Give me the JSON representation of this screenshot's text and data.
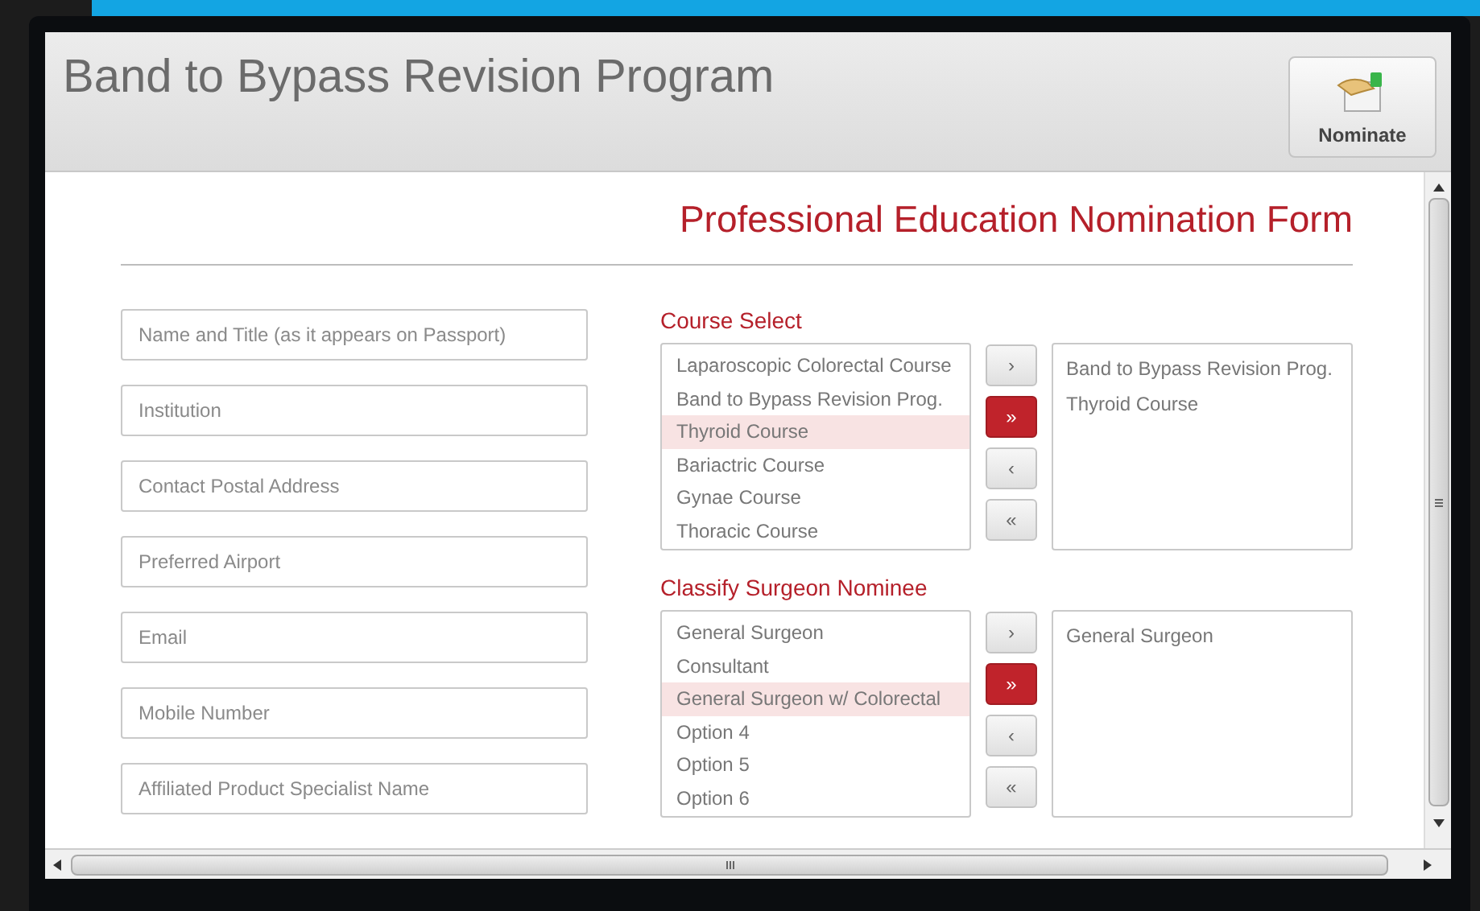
{
  "window": {
    "title": "Band to Bypass Revision Program"
  },
  "toolbar": {
    "nominate_button": "Nominate"
  },
  "form": {
    "title": "Professional Education Nomination Form",
    "fields": [
      {
        "placeholder": "Name and Title (as it appears on Passport)"
      },
      {
        "placeholder": "Institution"
      },
      {
        "placeholder": "Contact Postal Address"
      },
      {
        "placeholder": "Preferred Airport"
      },
      {
        "placeholder": "Email"
      },
      {
        "placeholder": "Mobile Number"
      },
      {
        "placeholder": "Affiliated Product Specialist Name"
      }
    ],
    "pickers": [
      {
        "heading": "Course Select",
        "available": [
          {
            "label": "Laparoscopic Colorectal Course",
            "selected": false
          },
          {
            "label": "Band to Bypass Revision Prog.",
            "selected": false
          },
          {
            "label": "Thyroid Course",
            "selected": true
          },
          {
            "label": "Bariactric Course",
            "selected": false
          },
          {
            "label": "Gynae Course",
            "selected": false
          },
          {
            "label": "Thoracic Course",
            "selected": false
          }
        ],
        "buttons": [
          {
            "label": "›",
            "highlighted": false
          },
          {
            "label": "»",
            "highlighted": true
          },
          {
            "label": "‹",
            "highlighted": false
          },
          {
            "label": "«",
            "highlighted": false
          }
        ],
        "chosen": [
          "Band to Bypass Revision Prog.",
          "Thyroid Course"
        ]
      },
      {
        "heading": "Classify Surgeon Nominee",
        "available": [
          {
            "label": "General Surgeon",
            "selected": false
          },
          {
            "label": "Consultant",
            "selected": false
          },
          {
            "label": "General Surgeon w/ Colorectal",
            "selected": true
          },
          {
            "label": "Option 4",
            "selected": false
          },
          {
            "label": "Option 5",
            "selected": false
          },
          {
            "label": "Option 6",
            "selected": false
          }
        ],
        "buttons": [
          {
            "label": "›",
            "highlighted": false
          },
          {
            "label": "»",
            "highlighted": true
          },
          {
            "label": "‹",
            "highlighted": false
          },
          {
            "label": "«",
            "highlighted": false
          }
        ],
        "chosen": [
          "General Surgeon"
        ]
      }
    ]
  }
}
